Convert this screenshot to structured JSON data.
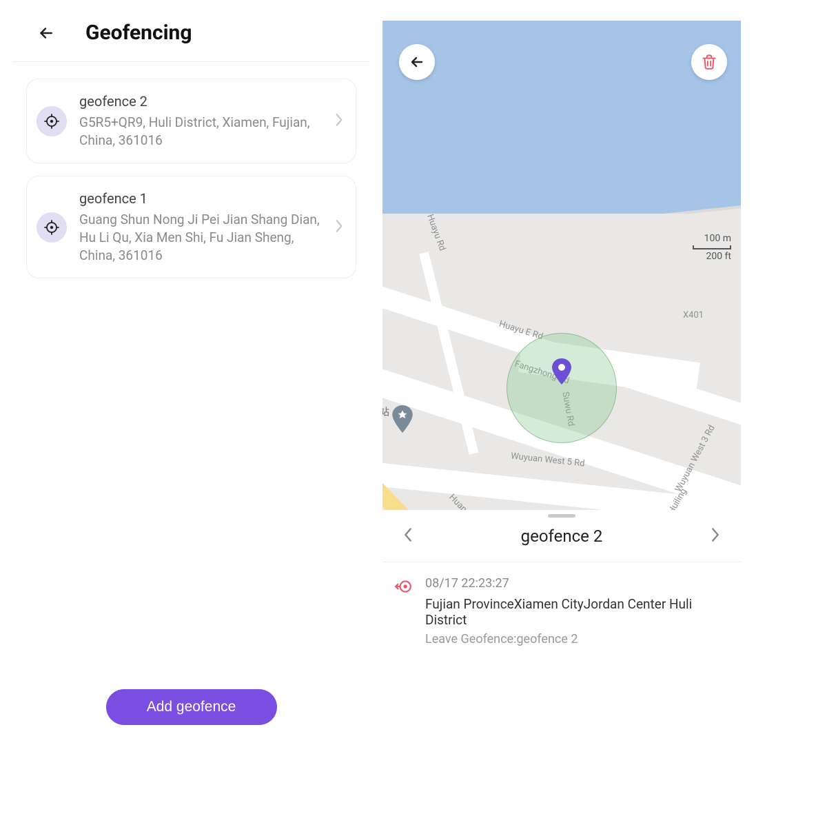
{
  "left": {
    "title": "Geofencing",
    "add_button": "Add geofence",
    "items": [
      {
        "name": "geofence 2",
        "address": "G5R5+QR9, Huli District, Xiamen, Fujian, China, 361016"
      },
      {
        "name": "geofence 1",
        "address": "Guang Shun Nong Ji Pei Jian Shang Dian, Hu Li Qu, Xia Men Shi, Fu Jian Sheng, China, 361016"
      }
    ]
  },
  "map": {
    "scale_m": "100 m",
    "scale_ft": "200 ft",
    "roads": {
      "huayu": "Huayu Rd",
      "huayu_e": "Huayu E Rd",
      "fangzhong": "Fangzhong Rd",
      "suwu": "Suwu Rd",
      "wuyuan_w5": "Wuyuan West 5 Rd",
      "huiling": "Huiling",
      "wuyuan_w3": "Wuyuan West 3 Rd",
      "huan": "Huan",
      "x401": "X401",
      "station": "站"
    }
  },
  "sheet": {
    "title": "geofence 2",
    "event": {
      "time": "08/17 22:23:27",
      "location": "Fujian ProvinceXiamen CityJordan Center Huli District",
      "desc": "Leave Geofence:geofence 2"
    }
  }
}
